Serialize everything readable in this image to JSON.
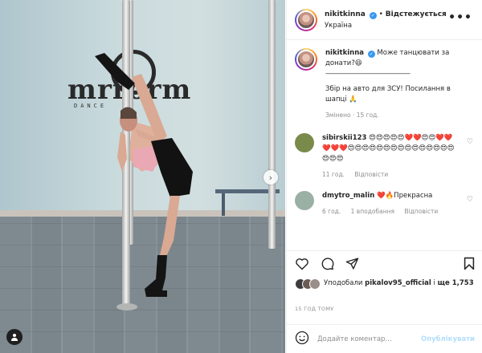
{
  "post": {
    "username": "nikitkinna",
    "verified_mark": "✓",
    "separator": "•",
    "follow_label": "Відстежується",
    "location": "Україна",
    "more_label": "•••"
  },
  "photo": {
    "studio_logo_text": "mrrorm",
    "studio_sub_text": "DANCE",
    "next_arrow": "›",
    "tag_icon": "person-tag-icon"
  },
  "caption": {
    "username": "nikitkinna",
    "line1": "Може танцювати за донати?😆",
    "divider": "——————————————",
    "line2": "Збір на авто для ЗСУ! Посилання в шапці 🙏",
    "edited": "Змінено · 15 год."
  },
  "comments": [
    {
      "username": "sibirskii123",
      "text": "😍😍😍😍😍❤️❤️😍😍❤️❤️❤️❤️❤️😍😍😍😍😍😍😍😍😍😍😍😍😍😍😍😍😍😍",
      "time": "11 год.",
      "reply": "Відповісти",
      "avatar_color": "#7a8a4a"
    },
    {
      "username": "dmytro_malin",
      "text": "❤️🔥Прекрасна",
      "time": "6 год.",
      "likes": "1 вподобання",
      "reply": "Відповісти",
      "avatar_color": "#9ab0a4"
    }
  ],
  "actions": {
    "like_icon": "heart-outline-icon",
    "comment_icon": "comment-bubble-icon",
    "share_icon": "paper-plane-icon",
    "save_icon": "bookmark-icon"
  },
  "likes": {
    "prefix": "Уподобали",
    "user": "pikalov95_official",
    "connector": "і",
    "others": "ще 1,753"
  },
  "timestamp": "15 ГОД ТОМУ",
  "add_comment": {
    "emoji_icon": "smiley-icon",
    "placeholder": "Додайте коментар…",
    "publish_label": "Опублікувати"
  },
  "colors": {
    "verified": "#3897f0",
    "publish_disabled": "#b2dffc",
    "muted": "#8e8e8e"
  }
}
